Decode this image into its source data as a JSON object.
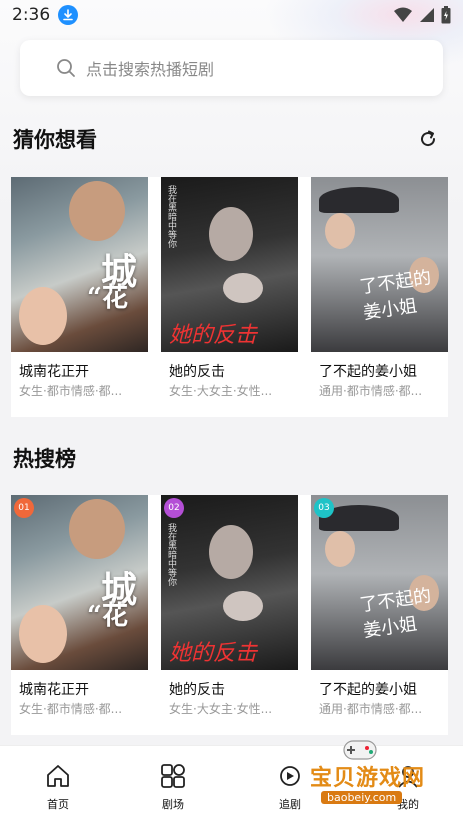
{
  "status_bar": {
    "time": "2:36"
  },
  "search": {
    "placeholder": "点击搜索热播短剧"
  },
  "sections": {
    "recommend": {
      "title": "猜你想看",
      "items": [
        {
          "title": "城南花正开",
          "tags": "女生·都市情感·都..."
        },
        {
          "title": "她的反击",
          "tags": "女生·大女主·女性..."
        },
        {
          "title": "了不起的姜小姐",
          "tags": "通用·都市情感·都..."
        }
      ]
    },
    "hot": {
      "title": "热搜榜",
      "items": [
        {
          "rank": "01",
          "title": "城南花正开",
          "tags": "女生·都市情感·都..."
        },
        {
          "rank": "02",
          "title": "她的反击",
          "tags": "女生·大女主·女性..."
        },
        {
          "rank": "03",
          "title": "了不起的姜小姐",
          "tags": "通用·都市情感·都..."
        }
      ]
    }
  },
  "posters": {
    "p1_line1": "城",
    "p1_line2": "“花",
    "p2_vertical": "我在黑暗中等你",
    "p2_script": "她的反击",
    "p3_script": "了不起的 姜小姐"
  },
  "rank_colors": [
    "#f0683a",
    "#b44fd6",
    "#1ec3c7"
  ],
  "bottom_nav": {
    "home": "首页",
    "theater": "剧场",
    "follow": "追剧",
    "mine": "我的"
  },
  "watermark": {
    "title": "宝贝游戏网",
    "url": "baobeiy.com"
  },
  "icons": {
    "search": "search-icon",
    "refresh": "refresh-icon",
    "download": "download-icon",
    "wifi": "wifi-icon",
    "signal": "signal-icon",
    "battery": "battery-icon"
  }
}
